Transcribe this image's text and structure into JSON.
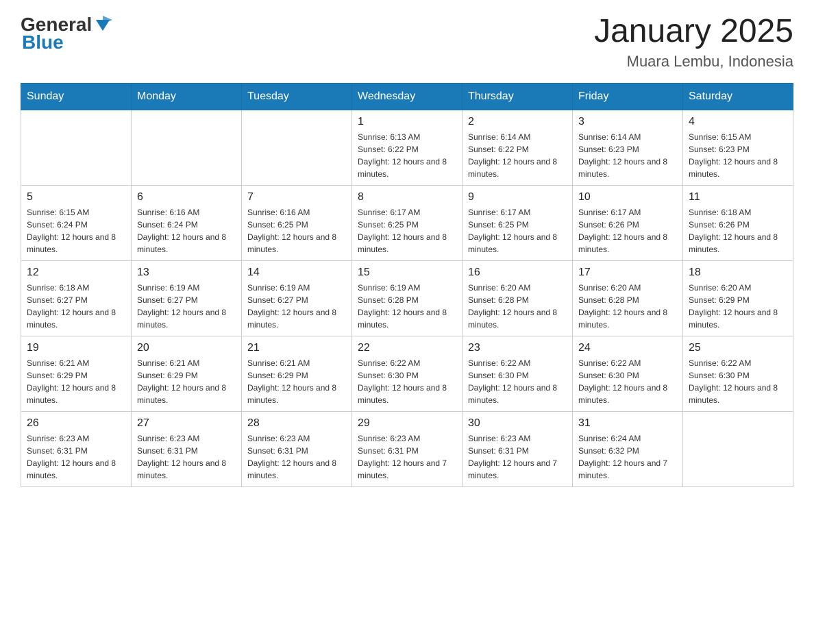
{
  "logo": {
    "text_general": "General",
    "text_blue": "Blue",
    "alt": "GeneralBlue Logo"
  },
  "header": {
    "title": "January 2025",
    "subtitle": "Muara Lembu, Indonesia"
  },
  "days_of_week": [
    "Sunday",
    "Monday",
    "Tuesday",
    "Wednesday",
    "Thursday",
    "Friday",
    "Saturday"
  ],
  "weeks": [
    [
      {
        "day": "",
        "info": ""
      },
      {
        "day": "",
        "info": ""
      },
      {
        "day": "",
        "info": ""
      },
      {
        "day": "1",
        "info": "Sunrise: 6:13 AM\nSunset: 6:22 PM\nDaylight: 12 hours and 8 minutes."
      },
      {
        "day": "2",
        "info": "Sunrise: 6:14 AM\nSunset: 6:22 PM\nDaylight: 12 hours and 8 minutes."
      },
      {
        "day": "3",
        "info": "Sunrise: 6:14 AM\nSunset: 6:23 PM\nDaylight: 12 hours and 8 minutes."
      },
      {
        "day": "4",
        "info": "Sunrise: 6:15 AM\nSunset: 6:23 PM\nDaylight: 12 hours and 8 minutes."
      }
    ],
    [
      {
        "day": "5",
        "info": "Sunrise: 6:15 AM\nSunset: 6:24 PM\nDaylight: 12 hours and 8 minutes."
      },
      {
        "day": "6",
        "info": "Sunrise: 6:16 AM\nSunset: 6:24 PM\nDaylight: 12 hours and 8 minutes."
      },
      {
        "day": "7",
        "info": "Sunrise: 6:16 AM\nSunset: 6:25 PM\nDaylight: 12 hours and 8 minutes."
      },
      {
        "day": "8",
        "info": "Sunrise: 6:17 AM\nSunset: 6:25 PM\nDaylight: 12 hours and 8 minutes."
      },
      {
        "day": "9",
        "info": "Sunrise: 6:17 AM\nSunset: 6:25 PM\nDaylight: 12 hours and 8 minutes."
      },
      {
        "day": "10",
        "info": "Sunrise: 6:17 AM\nSunset: 6:26 PM\nDaylight: 12 hours and 8 minutes."
      },
      {
        "day": "11",
        "info": "Sunrise: 6:18 AM\nSunset: 6:26 PM\nDaylight: 12 hours and 8 minutes."
      }
    ],
    [
      {
        "day": "12",
        "info": "Sunrise: 6:18 AM\nSunset: 6:27 PM\nDaylight: 12 hours and 8 minutes."
      },
      {
        "day": "13",
        "info": "Sunrise: 6:19 AM\nSunset: 6:27 PM\nDaylight: 12 hours and 8 minutes."
      },
      {
        "day": "14",
        "info": "Sunrise: 6:19 AM\nSunset: 6:27 PM\nDaylight: 12 hours and 8 minutes."
      },
      {
        "day": "15",
        "info": "Sunrise: 6:19 AM\nSunset: 6:28 PM\nDaylight: 12 hours and 8 minutes."
      },
      {
        "day": "16",
        "info": "Sunrise: 6:20 AM\nSunset: 6:28 PM\nDaylight: 12 hours and 8 minutes."
      },
      {
        "day": "17",
        "info": "Sunrise: 6:20 AM\nSunset: 6:28 PM\nDaylight: 12 hours and 8 minutes."
      },
      {
        "day": "18",
        "info": "Sunrise: 6:20 AM\nSunset: 6:29 PM\nDaylight: 12 hours and 8 minutes."
      }
    ],
    [
      {
        "day": "19",
        "info": "Sunrise: 6:21 AM\nSunset: 6:29 PM\nDaylight: 12 hours and 8 minutes."
      },
      {
        "day": "20",
        "info": "Sunrise: 6:21 AM\nSunset: 6:29 PM\nDaylight: 12 hours and 8 minutes."
      },
      {
        "day": "21",
        "info": "Sunrise: 6:21 AM\nSunset: 6:29 PM\nDaylight: 12 hours and 8 minutes."
      },
      {
        "day": "22",
        "info": "Sunrise: 6:22 AM\nSunset: 6:30 PM\nDaylight: 12 hours and 8 minutes."
      },
      {
        "day": "23",
        "info": "Sunrise: 6:22 AM\nSunset: 6:30 PM\nDaylight: 12 hours and 8 minutes."
      },
      {
        "day": "24",
        "info": "Sunrise: 6:22 AM\nSunset: 6:30 PM\nDaylight: 12 hours and 8 minutes."
      },
      {
        "day": "25",
        "info": "Sunrise: 6:22 AM\nSunset: 6:30 PM\nDaylight: 12 hours and 8 minutes."
      }
    ],
    [
      {
        "day": "26",
        "info": "Sunrise: 6:23 AM\nSunset: 6:31 PM\nDaylight: 12 hours and 8 minutes."
      },
      {
        "day": "27",
        "info": "Sunrise: 6:23 AM\nSunset: 6:31 PM\nDaylight: 12 hours and 8 minutes."
      },
      {
        "day": "28",
        "info": "Sunrise: 6:23 AM\nSunset: 6:31 PM\nDaylight: 12 hours and 8 minutes."
      },
      {
        "day": "29",
        "info": "Sunrise: 6:23 AM\nSunset: 6:31 PM\nDaylight: 12 hours and 7 minutes."
      },
      {
        "day": "30",
        "info": "Sunrise: 6:23 AM\nSunset: 6:31 PM\nDaylight: 12 hours and 7 minutes."
      },
      {
        "day": "31",
        "info": "Sunrise: 6:24 AM\nSunset: 6:32 PM\nDaylight: 12 hours and 7 minutes."
      },
      {
        "day": "",
        "info": ""
      }
    ]
  ]
}
